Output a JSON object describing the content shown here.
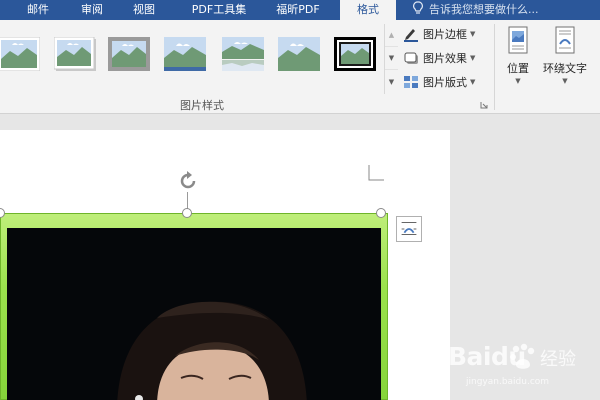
{
  "tabs": [
    {
      "label": "邮件",
      "active": false
    },
    {
      "label": "审阅",
      "active": false
    },
    {
      "label": "视图",
      "active": false
    },
    {
      "label": "PDF工具集",
      "active": false
    },
    {
      "label": "福昕PDF",
      "active": false
    },
    {
      "label": "格式",
      "active": true
    }
  ],
  "tellme": {
    "text": "告诉我您想要做什么..."
  },
  "ribbon": {
    "picture_styles": {
      "group_label": "图片样式",
      "selected_index": 6
    },
    "picture_border": "图片边框",
    "picture_effects": "图片效果",
    "picture_layout": "图片版式",
    "position": "位置",
    "wrap_text": "环绕文字"
  },
  "watermark": {
    "brand": "Baidu",
    "sub": "经验",
    "url": "jingyan.baidu.com"
  },
  "colors": {
    "ribbon_blue": "#2b579a",
    "ribbon_bg": "#f3f3f3",
    "frame_green": "#9be24d",
    "photo_bg": "#05070a"
  }
}
